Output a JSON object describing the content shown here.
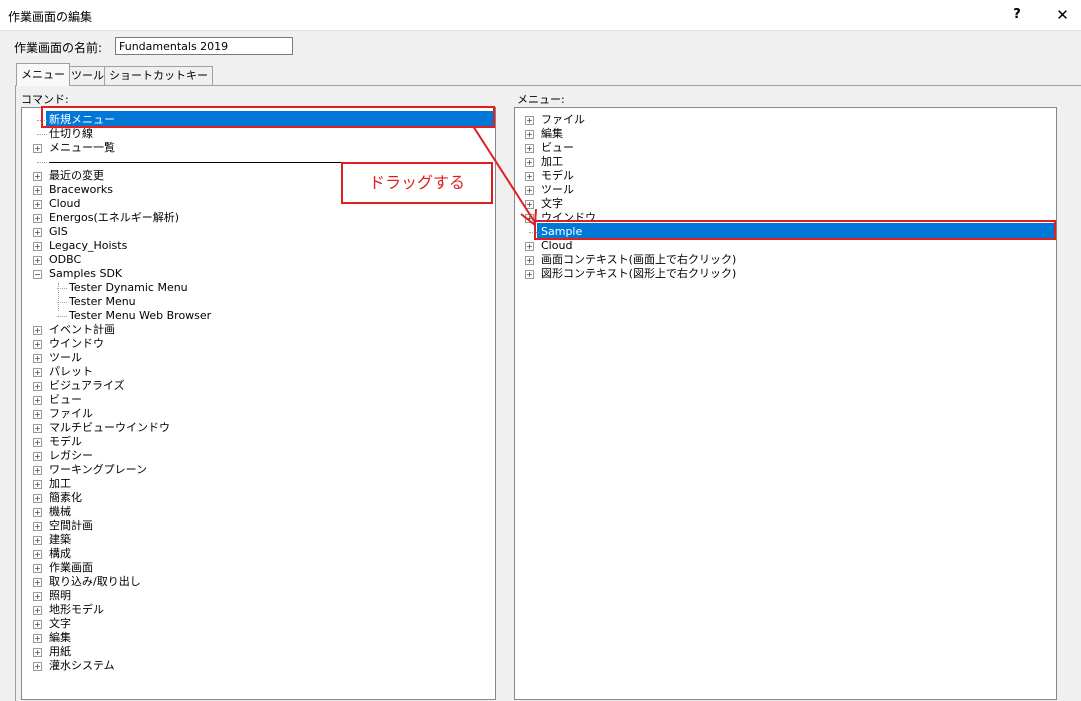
{
  "window": {
    "title": "作業画面の編集",
    "help": "?",
    "close": "✕"
  },
  "name_field": {
    "label": "作業画面の名前:",
    "value": "Fundamentals 2019"
  },
  "tabs": [
    "メニュー",
    "ツール",
    "ショートカットキー"
  ],
  "commands": {
    "label": "コマンド:",
    "items": [
      "新規メニュー",
      "仕切り線",
      "メニュー一覧",
      "",
      "最近の変更",
      "Braceworks",
      "Cloud",
      "Energos(エネルギー解析)",
      "GIS",
      "Legacy_Hoists",
      "ODBC",
      "Samples SDK",
      "Tester Dynamic Menu",
      "Tester Menu",
      "Tester Menu Web Browser",
      "イベント計画",
      "ウインドウ",
      "ツール",
      "パレット",
      "ビジュアライズ",
      "ビュー",
      "ファイル",
      "マルチビューウインドウ",
      "モデル",
      "レガシー",
      "ワーキングプレーン",
      "加工",
      "簡素化",
      "機械",
      "空間計画",
      "建築",
      "構成",
      "作業画面",
      "取り込み/取り出し",
      "照明",
      "地形モデル",
      "文字",
      "編集",
      "用紙",
      "灌水システム"
    ]
  },
  "menus": {
    "label": "メニュー:",
    "items": [
      "ファイル",
      "編集",
      "ビュー",
      "加工",
      "モデル",
      "ツール",
      "文字",
      "ウインドウ",
      "Sample",
      "Cloud",
      "画面コンテキスト(画面上で右クリック)",
      "図形コンテキスト(図形上で右クリック)"
    ]
  },
  "annotation": {
    "text": "ドラッグする",
    "color": "#e02020"
  },
  "colors": {
    "selection": "#0078d7",
    "highlight": "#e02020"
  }
}
